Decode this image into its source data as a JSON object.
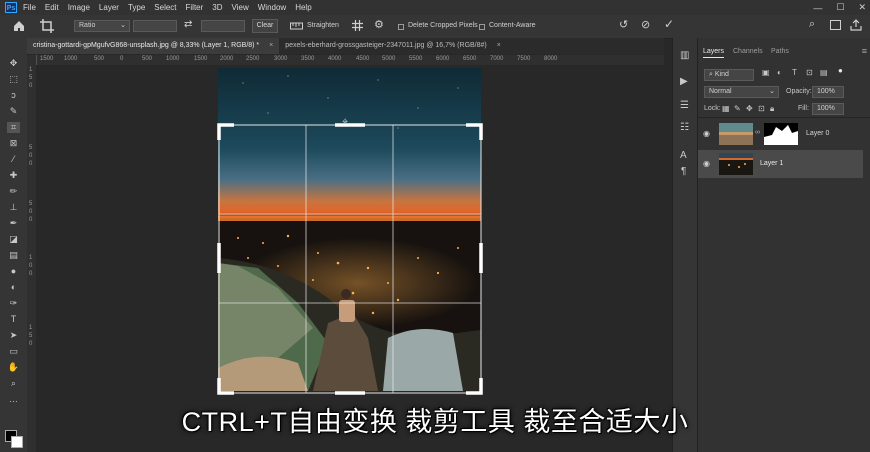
{
  "menubar": {
    "app_icon": "Ps",
    "items": [
      "File",
      "Edit",
      "Image",
      "Layer",
      "Type",
      "Select",
      "Filter",
      "3D",
      "View",
      "Window",
      "Help"
    ],
    "window_controls": [
      "minimize-icon",
      "maximize-icon",
      "close-icon"
    ]
  },
  "options": {
    "ratio_label": "Ratio",
    "clear_label": "Clear",
    "straighten_label": "Straighten",
    "delete_cropped_label": "Delete Cropped Pixels",
    "content_aware_label": "Content-Aware"
  },
  "tabs": [
    {
      "label": "cristina-gottardi-gpMgufvG868-unsplash.jpg @ 8,33% (Layer 1, RGB/8) *",
      "active": true
    },
    {
      "label": "pexels-eberhard-grossgasteiger-2347011.jpg @ 16,7% (RGB/8#)",
      "active": false
    }
  ],
  "ruler": {
    "h_ticks": [
      "1500",
      "1000",
      "500",
      "0",
      "500",
      "1000",
      "1500",
      "2000",
      "2500",
      "3000",
      "3500",
      "4000",
      "4500",
      "5000",
      "5500",
      "6000",
      "6500",
      "7000",
      "7500",
      "8000"
    ],
    "v_ticks": [
      "1",
      "5",
      "0",
      "5",
      "0",
      "0",
      "5",
      "0",
      "0",
      "1",
      "0",
      "0",
      "1",
      "5",
      "0"
    ]
  },
  "panel": {
    "tabs": [
      "Layers",
      "Channels",
      "Paths"
    ],
    "filter_kind": "Kind",
    "blend_mode": "Normal",
    "opacity_label": "Opacity:",
    "opacity_value": "100%",
    "lock_label": "Lock:",
    "fill_label": "Fill:",
    "fill_value": "100%",
    "layers": [
      {
        "name": "Layer 0",
        "visible": true,
        "selected": false
      },
      {
        "name": "Layer 1",
        "visible": true,
        "selected": true
      }
    ]
  },
  "caption": "CTRL+T自由变换 裁剪工具 裁至合适大小",
  "colors": {
    "accent": "#31a8ff",
    "menubar": "#323232",
    "panel": "#323232",
    "canvas_bg": "#282828"
  }
}
